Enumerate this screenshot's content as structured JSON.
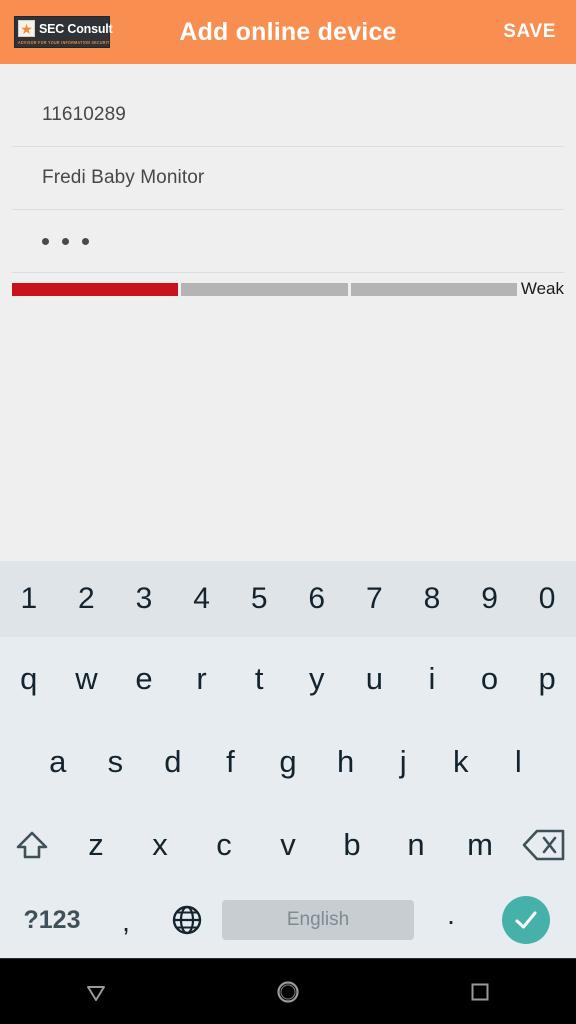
{
  "appbar": {
    "logo_name": "SEC Consult",
    "logo_tagline": "ADVISOR FOR YOUR INFORMATION SECURITY",
    "title": "Add online device",
    "save_label": "SAVE",
    "background_color": "#f88e50"
  },
  "form": {
    "device_id": "11610289",
    "device_name": "Fredi Baby Monitor",
    "password_masked": "•••",
    "password_dot_count": 3,
    "password_strength": {
      "label": "Weak",
      "segments_total": 3,
      "segments_filled": 1,
      "filled_color": "#c8121c",
      "empty_color": "#b4b4b4"
    },
    "background_color": "#efefef"
  },
  "keyboard": {
    "background_color": "#e7ecf0",
    "number_row_background": "#dfe4e9",
    "rows": {
      "numbers": [
        "1",
        "2",
        "3",
        "4",
        "5",
        "6",
        "7",
        "8",
        "9",
        "0"
      ],
      "qwerty": [
        "q",
        "w",
        "e",
        "r",
        "t",
        "y",
        "u",
        "i",
        "o",
        "p"
      ],
      "asdf": [
        "a",
        "s",
        "d",
        "f",
        "g",
        "h",
        "j",
        "k",
        "l"
      ],
      "zxcv": [
        "z",
        "x",
        "c",
        "v",
        "b",
        "n",
        "m"
      ]
    },
    "shift_icon": "shift-arrow-up-icon",
    "backspace_icon": "backspace-delete-icon",
    "symbols_label": "?123",
    "comma_label": ",",
    "globe_icon": "globe-language-icon",
    "space_label": "English",
    "period_label": ".",
    "enter_icon": "checkmark-icon",
    "enter_color": "#45b1a8",
    "space_background": "#c7cdd1"
  },
  "navbar": {
    "back_icon": "triangle-down-back-icon",
    "home_icon": "circle-home-icon",
    "recents_icon": "square-recents-icon",
    "background_color": "#000000"
  }
}
